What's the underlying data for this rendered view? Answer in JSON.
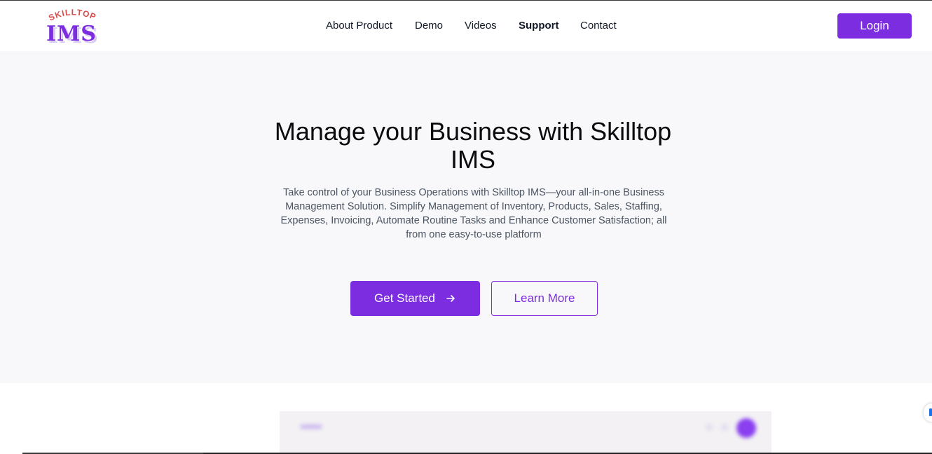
{
  "colors": {
    "brand": "#7c2ddf",
    "hero_background": "#f8f8fa",
    "logo_top": "#d84b4b",
    "logo_main": "#7c2ddf"
  },
  "logo": {
    "top_text": "SKILLTOP",
    "main_text": "IMS"
  },
  "nav": {
    "items": [
      {
        "label": "About Product",
        "active": false
      },
      {
        "label": "Demo",
        "active": false
      },
      {
        "label": "Videos",
        "active": false
      },
      {
        "label": "Support",
        "active": true
      },
      {
        "label": "Contact",
        "active": false
      }
    ],
    "login_label": "Login"
  },
  "hero": {
    "title": "Manage your Business with Skilltop IMS",
    "description": "Take control of your Business Operations with Skilltop IMS—your all-in-one Business Management Solution. Simplify Management of Inventory, Products, Sales, Staffing, Expenses, Invoicing, Automate Routine Tasks and Enhance Customer Satisfaction; all from one easy-to-use platform",
    "primary_button": "Get Started",
    "primary_button_icon": "arrow-right-icon",
    "secondary_button": "Learn More"
  }
}
